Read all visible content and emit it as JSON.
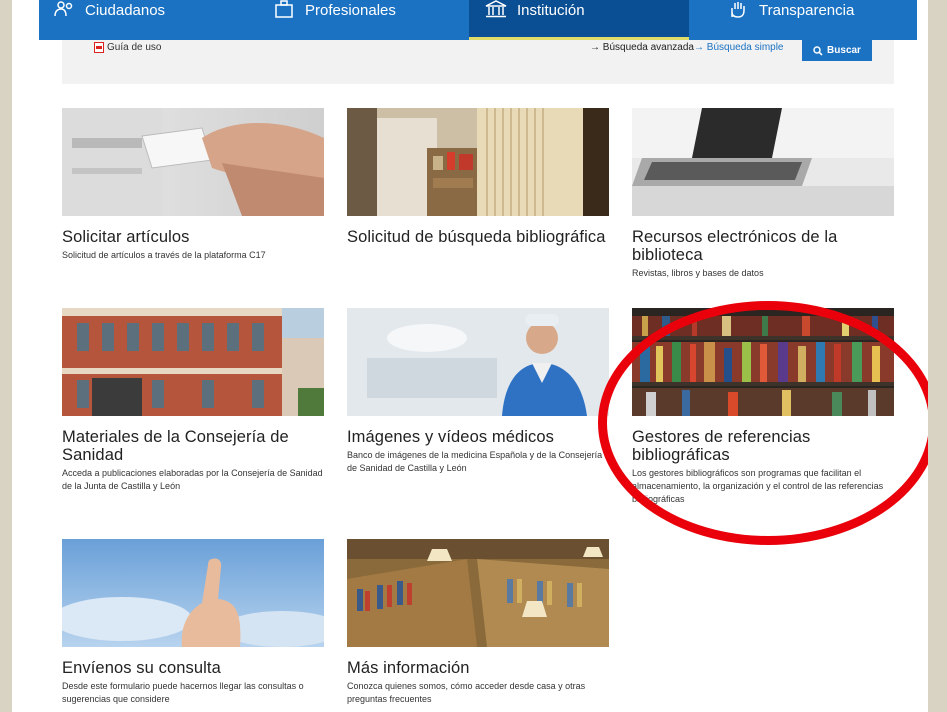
{
  "nav": [
    {
      "label": "Ciudadanos",
      "icon": "people-icon",
      "active": false
    },
    {
      "label": "Profesionales",
      "icon": "briefcase-icon",
      "active": false
    },
    {
      "label": "Institución",
      "icon": "institution-icon",
      "active": true
    },
    {
      "label": "Transparencia",
      "icon": "hand-icon",
      "active": false
    }
  ],
  "search": {
    "guide_label": "Guía de uso",
    "advanced_label": "→ Búsqueda avanzada",
    "simple_label": "→ Búsqueda simple",
    "search_button": "Buscar"
  },
  "cards": [
    {
      "title": "Solicitar artículos",
      "desc": "Solicitud de artículos a través de la plataforma C17"
    },
    {
      "title": "Solicitud de búsqueda bibliográfica",
      "desc": ""
    },
    {
      "title": "Recursos electrónicos de la biblioteca",
      "desc": "Revistas, libros y bases de datos"
    },
    {
      "title": "Materiales de la Consejería de Sanidad",
      "desc": "Acceda a publicaciones elaboradas por la Consejería de Sanidad de la Junta de Castilla y León"
    },
    {
      "title": "Imágenes y vídeos médicos",
      "desc": "Banco de imágenes de la medicina Española y de la Consejería de Sanidad de Castilla y León"
    },
    {
      "title": "Gestores de referencias bibliográficas",
      "desc": "Los gestores bibliográficos son programas que facilitan el almacenamiento, la organización y el control de las referencias bibliográficas"
    },
    {
      "title": "Envíenos su consulta",
      "desc": "Desde este formulario puede hacernos llegar las consultas o sugerencias que considere"
    },
    {
      "title": "Más información",
      "desc": "Conozca quienes somos, cómo acceder desde casa y otras preguntas frecuentes"
    }
  ],
  "colors": {
    "nav_bg": "#1b72c2",
    "nav_active": "#0a4f93",
    "highlight": "#e9000a"
  }
}
